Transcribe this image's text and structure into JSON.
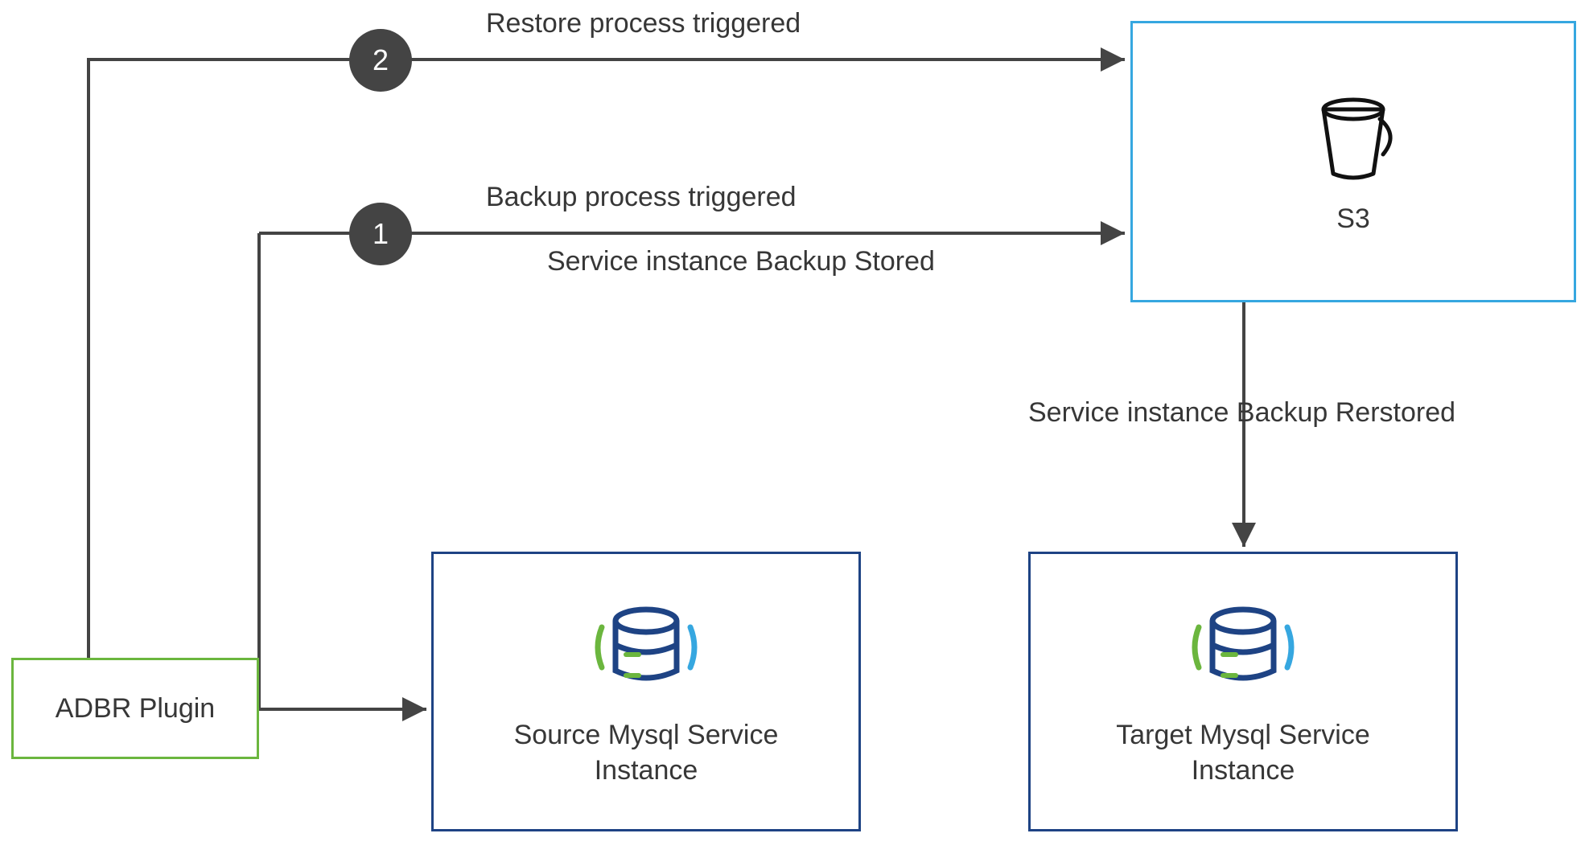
{
  "nodes": {
    "adbr": {
      "label": "ADBR Plugin"
    },
    "s3": {
      "label": "S3"
    },
    "source": {
      "label": "Source Mysql Service\nInstance"
    },
    "target": {
      "label": "Target Mysql Service\nInstance"
    }
  },
  "steps": {
    "one": "1",
    "two": "2"
  },
  "edges": {
    "restore_trigger": "Restore process triggered",
    "backup_trigger": "Backup process triggered",
    "backup_stored": "Service instance Backup Stored",
    "backup_restored": "Service instance Backup Rerstored"
  },
  "colors": {
    "green": "#6bb63e",
    "blue": "#36a7e0",
    "navy": "#1e4384",
    "dark": "#444444",
    "text": "#373737"
  }
}
